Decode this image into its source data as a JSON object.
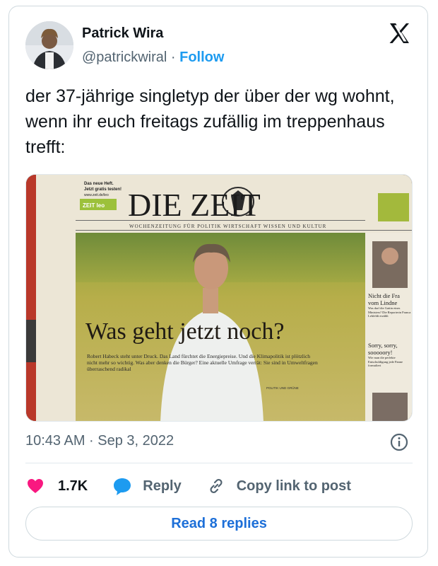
{
  "tweet": {
    "author": {
      "name": "Patrick Wira",
      "handle": "@patrickwiral",
      "separator": "·",
      "follow_label": "Follow"
    },
    "text": "der 37-jährige singletyp der über der wg wohnt, wenn ihr euch freitags zufällig im treppenhaus trefft:",
    "timestamp": "10:43 AM · Sep 3, 2022",
    "actions": {
      "like_count": "1.7K",
      "reply_label": "Reply",
      "copy_link_label": "Copy link to post"
    },
    "read_replies_label": "Read 8 replies"
  },
  "image": {
    "masthead": "DIE ZEIT",
    "promo_line1": "Das neue Heft.",
    "promo_line2": "Jetzt gratis testen!",
    "promo_url": "www.zeit.de/leo",
    "promo_badge": "ZEIT leo",
    "tagline": "WOCHENZEITUNG FÜR POLITIK WIRTSCHAFT WISSEN UND KULTUR",
    "headline": "Was geht jetzt noch?",
    "subtext": "Robert Habeck steht unter Druck. Das Land fürchtet die Energiepreise. Und die Klimapolitik ist plötzlich nicht mehr so wichtig. Was aber denken die Bürger? Eine aktuelle Umfrage verrät: Sie sind in Umweltfragen überraschend radikal",
    "section_tag": "POLITIK UND GRÜNE",
    "side_teaser1_title": "Nicht die Fra vom Lindne",
    "side_teaser1_body": "Was darf die Gattin eines Ministers? Die Reporterin Franca Lehfeldt erzählt",
    "side_teaser2_title": "Sorry, sorry, sooooory!",
    "side_teaser2_body": "Wie man die perfekte Entschuldigung jede Panne formuliert"
  },
  "colors": {
    "link_blue": "#1d9bf0",
    "heart_pink": "#f91880",
    "reply_bubble_blue": "#1d9bf0",
    "muted_text": "#536471"
  }
}
